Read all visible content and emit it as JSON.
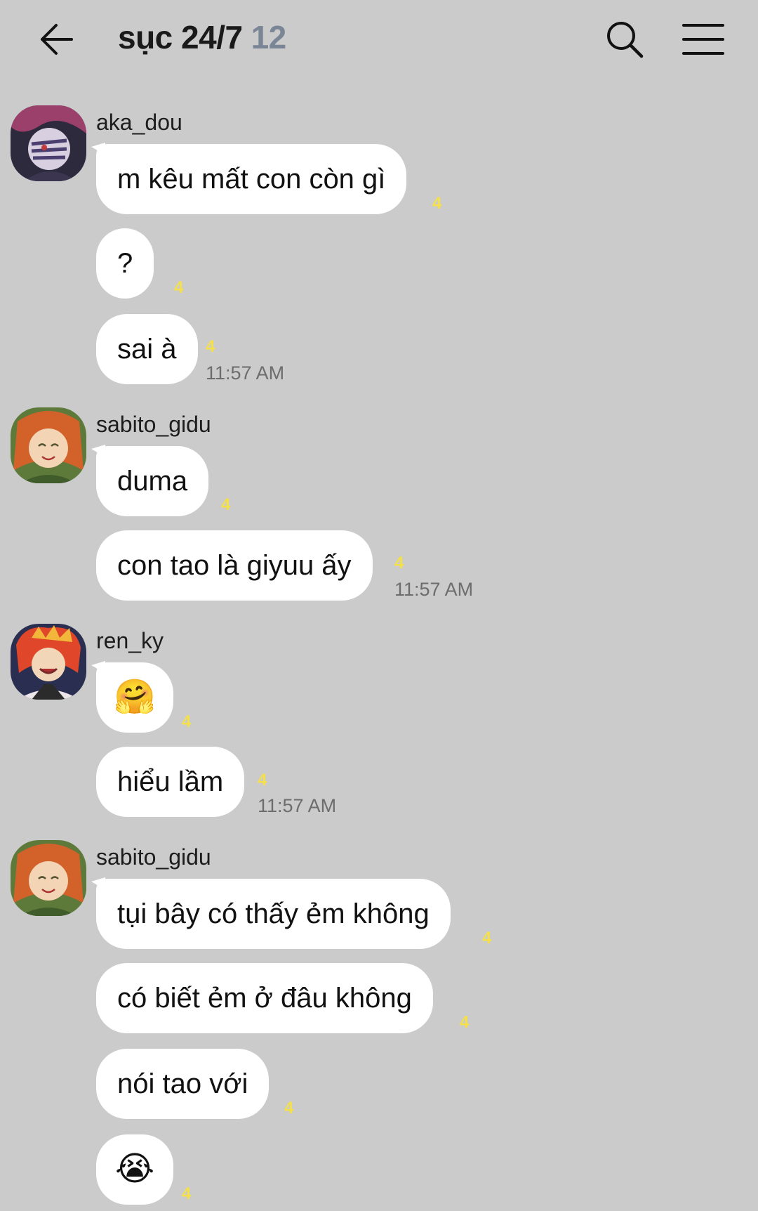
{
  "header": {
    "title": "sục 24/7",
    "member_count": "12",
    "back_icon": "arrow-left-icon",
    "search_icon": "search-icon",
    "menu_icon": "menu-icon"
  },
  "colors": {
    "background": "#cbcbcb",
    "bubble": "#ffffff",
    "unread": "#f4e04a",
    "member_count": "#7a8696"
  },
  "groups": [
    {
      "sender": "aka_dou",
      "messages": [
        {
          "text": "m kêu mất con còn gì",
          "unread": "4"
        },
        {
          "text": "?",
          "unread": "4"
        },
        {
          "text": "sai à",
          "unread": "4",
          "time": "11:57 AM"
        }
      ]
    },
    {
      "sender": "sabito_gidu",
      "messages": [
        {
          "text": "duma",
          "unread": "4"
        },
        {
          "text": "con tao là giyuu ấy",
          "unread": "4",
          "time": "11:57 AM"
        }
      ]
    },
    {
      "sender": "ren_ky",
      "messages": [
        {
          "text": "🤗",
          "unread": "4"
        },
        {
          "text": "hiểu lầm",
          "unread": "4",
          "time": "11:57 AM"
        }
      ]
    },
    {
      "sender": "sabito_gidu",
      "messages": [
        {
          "text": "tụi bây có thấy ẻm không",
          "unread": "4"
        },
        {
          "text": "có biết ẻm ở đâu không",
          "unread": "4"
        },
        {
          "text": "nói tao với",
          "unread": "4"
        },
        {
          "text": "😭",
          "unread": "4"
        }
      ]
    }
  ]
}
